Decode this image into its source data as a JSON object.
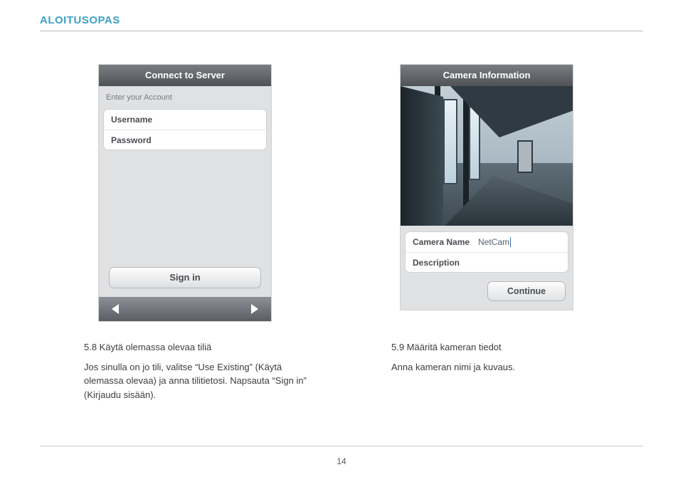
{
  "header": "ALOITUSOPAS",
  "page_number": "14",
  "left_phone": {
    "title": "Connect to Server",
    "subhead": "Enter your Account",
    "username_label": "Username",
    "password_label": "Password",
    "signin_label": "Sign in"
  },
  "right_phone": {
    "title": "Camera Information",
    "camera_name_label": "Camera Name",
    "camera_name_value": "NetCam",
    "description_label": "Description",
    "continue_label": "Continue"
  },
  "captions": {
    "left_title": "5.8 Käytä olemassa olevaa tiliä",
    "left_body": "Jos sinulla on jo tili, valitse “Use Existing” (Käytä olemassa olevaa) ja anna tilitietosi. Napsauta “Sign in” (Kirjaudu sisään).",
    "right_title": "5.9 Määritä kameran tiedot",
    "right_body": "Anna kameran nimi ja kuvaus."
  }
}
